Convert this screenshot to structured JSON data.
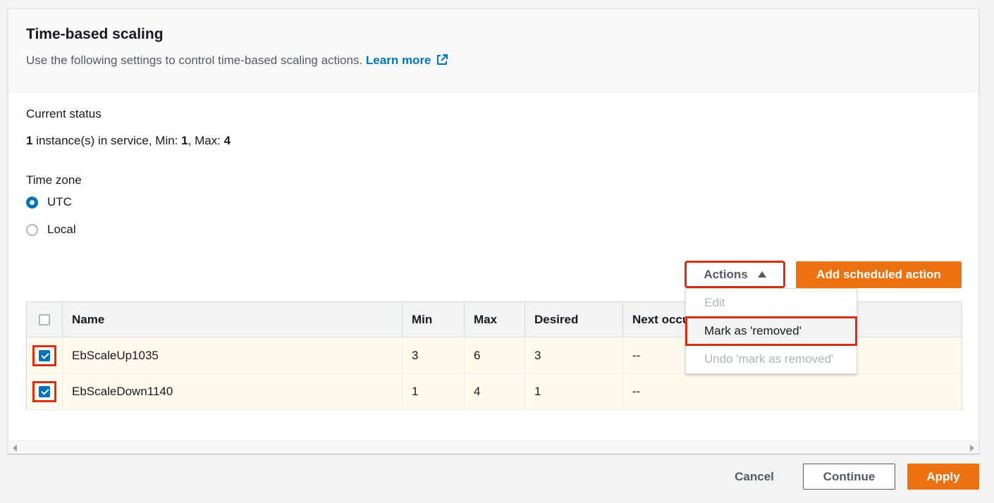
{
  "panel": {
    "title": "Time-based scaling",
    "description": "Use the following settings to control time-based scaling actions.",
    "learn_more": "Learn more"
  },
  "status": {
    "label": "Current status",
    "instances": "1",
    "instances_text": " instance(s) in service, Min: ",
    "min": "1",
    "max_text": ", Max: ",
    "max": "4"
  },
  "timezone": {
    "label": "Time zone",
    "options": [
      "UTC",
      "Local"
    ],
    "selected": "UTC"
  },
  "toolbar": {
    "actions_label": "Actions",
    "add_label": "Add scheduled action"
  },
  "dropdown": {
    "items": [
      "Edit",
      "Mark as 'removed'",
      "Undo 'mark as removed'"
    ]
  },
  "table": {
    "headers": [
      "Name",
      "Min",
      "Max",
      "Desired",
      "Next occu"
    ],
    "rows": [
      {
        "name": "EbScaleUp1035",
        "min": "3",
        "max": "6",
        "desired": "3",
        "next": "--",
        "checked": true
      },
      {
        "name": "EbScaleDown1140",
        "min": "1",
        "max": "4",
        "desired": "1",
        "next": "--",
        "checked": true
      }
    ]
  },
  "footer": {
    "cancel": "Cancel",
    "continue": "Continue",
    "apply": "Apply"
  },
  "colors": {
    "accent": "#0073bb",
    "primary_button": "#ec7211",
    "highlight": "#d13212",
    "selected_row": "#fefbec"
  }
}
